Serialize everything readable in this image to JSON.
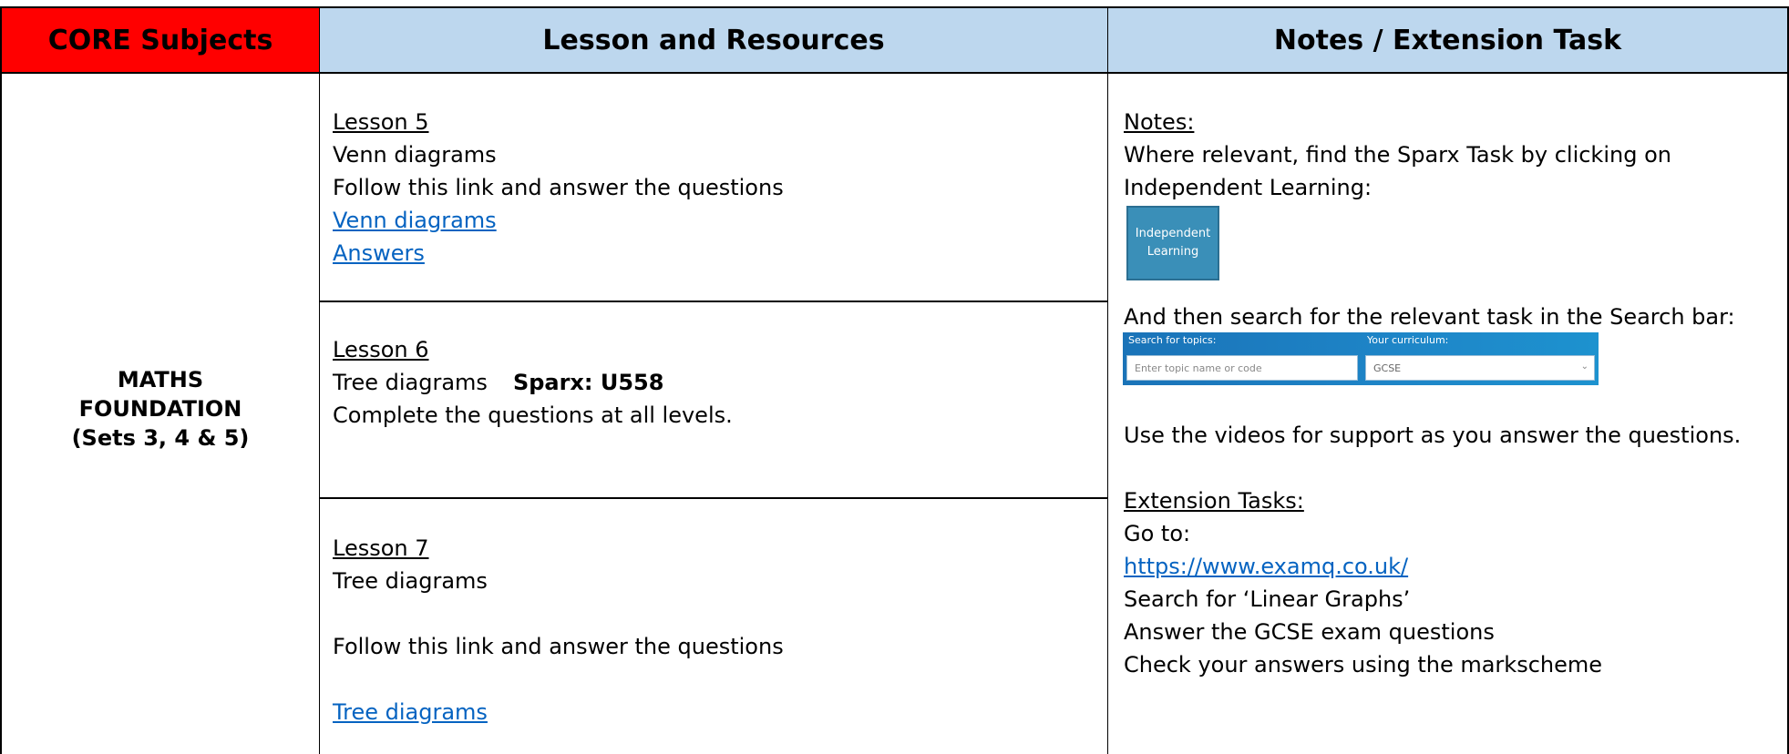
{
  "header": {
    "core": "CORE Subjects",
    "lesson": "Lesson and Resources",
    "notes": "Notes / Extension Task"
  },
  "subject": {
    "line1": "MATHS",
    "line2": "FOUNDATION",
    "line3": "(Sets 3, 4 & 5)"
  },
  "lessons": [
    {
      "title": "Lesson 5",
      "topic": "Venn diagrams",
      "instruction": "Follow this link and answer the questions",
      "link1": "Venn diagrams",
      "link2": "Answers"
    },
    {
      "title": "Lesson 6",
      "topic": "Tree diagrams",
      "code": "Sparx: U558",
      "instruction": "Complete the questions at all levels."
    },
    {
      "title": "Lesson 7",
      "topic": "Tree diagrams",
      "instruction": "Follow this link and answer the questions",
      "link": "Tree diagrams"
    }
  ],
  "notes": {
    "heading": "Notes:",
    "line1": "Where relevant, find the Sparx Task by clicking on",
    "line2": "Independent Learning:",
    "button_line1": "Independent",
    "button_line2": "Learning",
    "search_line": "And then search for the relevant task in the Search bar:",
    "search_label": "Search for topics:",
    "search_placeholder": "Enter topic name or code",
    "curriculum_label": "Your curriculum:",
    "curriculum_value": "GCSE",
    "videos_line": "Use the videos for support as you answer the questions."
  },
  "extension": {
    "heading": "Extension Tasks:",
    "goto": "Go to:",
    "url": "https://www.examq.co.uk/",
    "search": "Search for ‘Linear Graphs’",
    "answer": "Answer the GCSE exam questions",
    "check": "Check your answers using the markscheme"
  }
}
